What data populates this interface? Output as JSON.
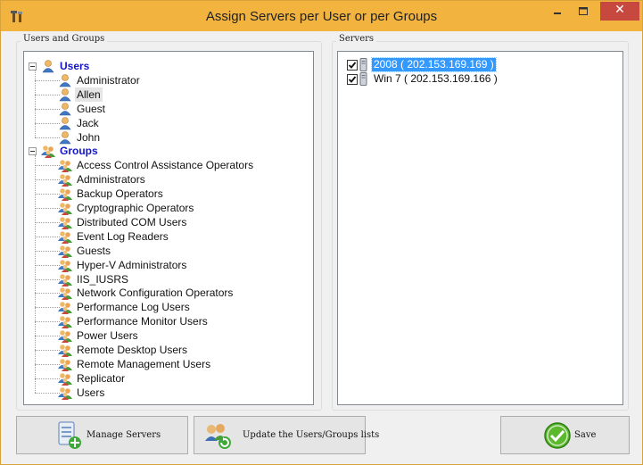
{
  "window": {
    "title": "Assign Servers per User or per Groups",
    "title_bar_color": "#f2b43f",
    "close_button_color": "#c7483e"
  },
  "users_groups_panel": {
    "label": "Users and Groups",
    "users_root": "Users",
    "users": [
      "Administrator",
      "Allen",
      "Guest",
      "Jack",
      "John"
    ],
    "selected_user": "Allen",
    "groups_root": "Groups",
    "groups": [
      "Access Control Assistance Operators",
      "Administrators",
      "Backup Operators",
      "Cryptographic Operators",
      "Distributed COM Users",
      "Event Log Readers",
      "Guests",
      "Hyper-V Administrators",
      "IIS_IUSRS",
      "Network Configuration Operators",
      "Performance Log Users",
      "Performance Monitor Users",
      "Power Users",
      "Remote Desktop Users",
      "Remote Management Users",
      "Replicator",
      "Users"
    ]
  },
  "servers_panel": {
    "label": "Servers",
    "servers": [
      {
        "label": "2008 ( 202.153.169.169 )",
        "checked": true,
        "selected": true
      },
      {
        "label": "Win 7 ( 202.153.169.166 )",
        "checked": true,
        "selected": false
      }
    ],
    "selection_color": "#3399ff"
  },
  "buttons": {
    "manage_servers": "Manage Servers",
    "update_lists": "Update the Users/Groups lists",
    "save": "Save"
  }
}
